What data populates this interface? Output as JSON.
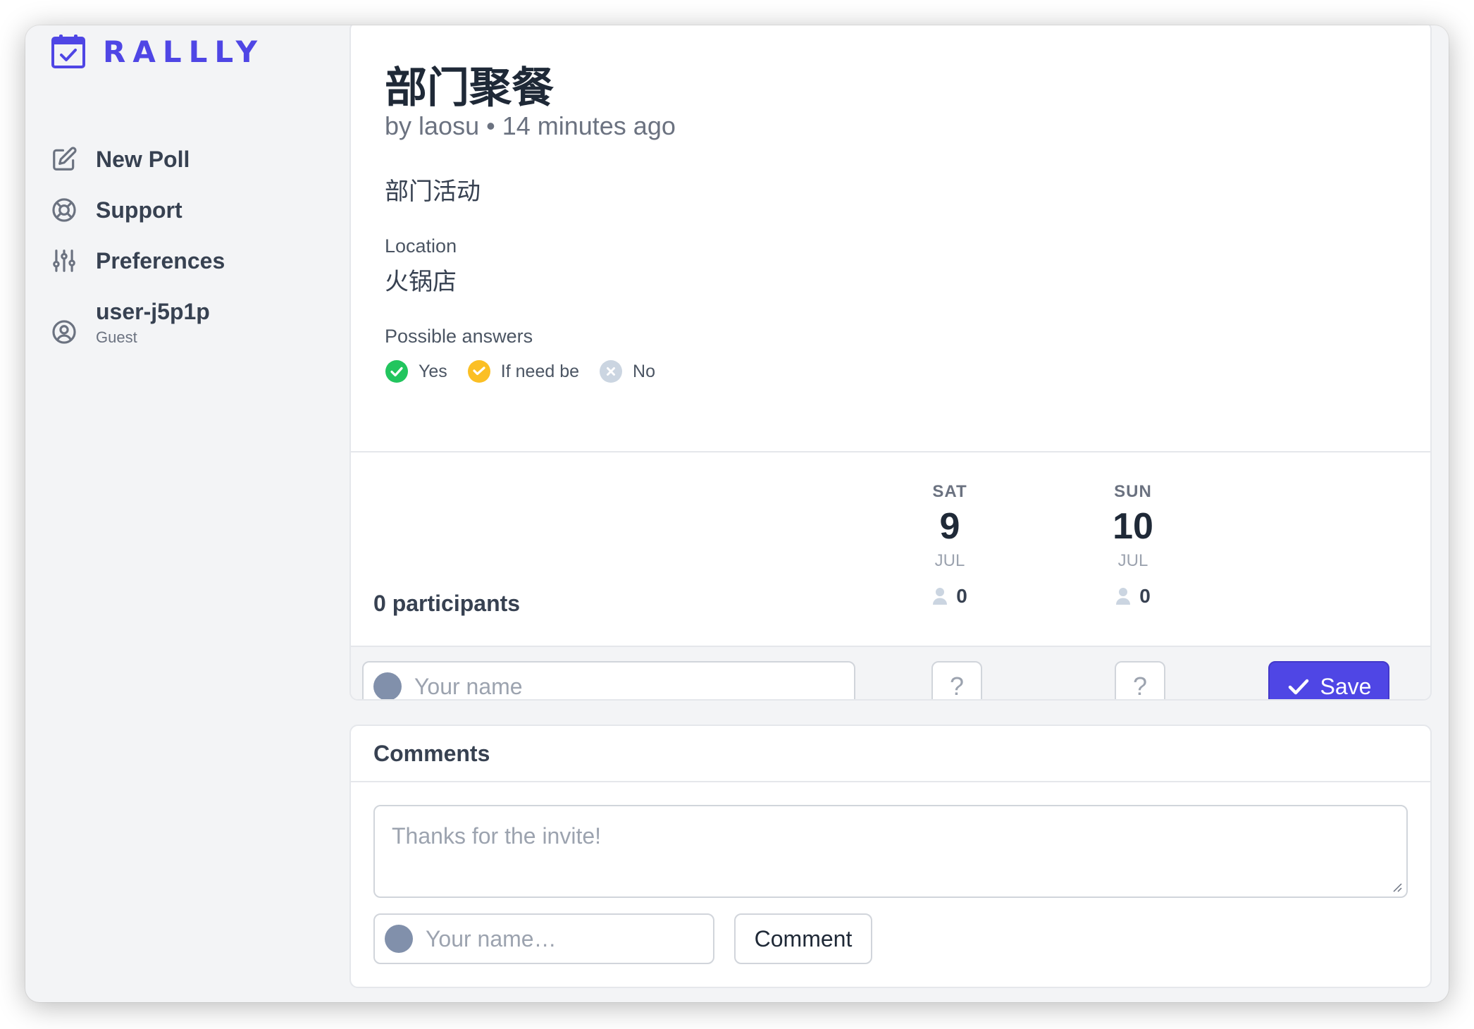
{
  "app": {
    "brand": "RALLLY",
    "accent": "#4f46e5"
  },
  "sidebar": {
    "items": [
      {
        "label": "New Poll",
        "icon": "pencil-square-icon"
      },
      {
        "label": "Support",
        "icon": "life-ring-icon"
      },
      {
        "label": "Preferences",
        "icon": "sliders-icon"
      }
    ],
    "user": {
      "name": "user-j5p1p",
      "role": "Guest",
      "icon": "user-circle-icon"
    }
  },
  "poll": {
    "title": "部门聚餐",
    "meta": "by laosu • 14 minutes ago",
    "description": "部门活动",
    "location_label": "Location",
    "location": "火锅店",
    "answers_label": "Possible answers",
    "answers": [
      {
        "label": "Yes",
        "color": "#22c55e"
      },
      {
        "label": "If need be",
        "color": "#fbbf24"
      },
      {
        "label": "No",
        "color": "#cbd5e1"
      }
    ],
    "participants": "0 participants",
    "options": [
      {
        "day": "SAT",
        "date": "9",
        "month": "JUL",
        "count": "0"
      },
      {
        "day": "SUN",
        "date": "10",
        "month": "JUL",
        "count": "0"
      }
    ],
    "name_placeholder": "Your name",
    "vote_placeholder": "?",
    "save_label": "Save"
  },
  "comments": {
    "title": "Comments",
    "placeholder": "Thanks for the invite!",
    "name_placeholder": "Your name…",
    "button_label": "Comment"
  }
}
